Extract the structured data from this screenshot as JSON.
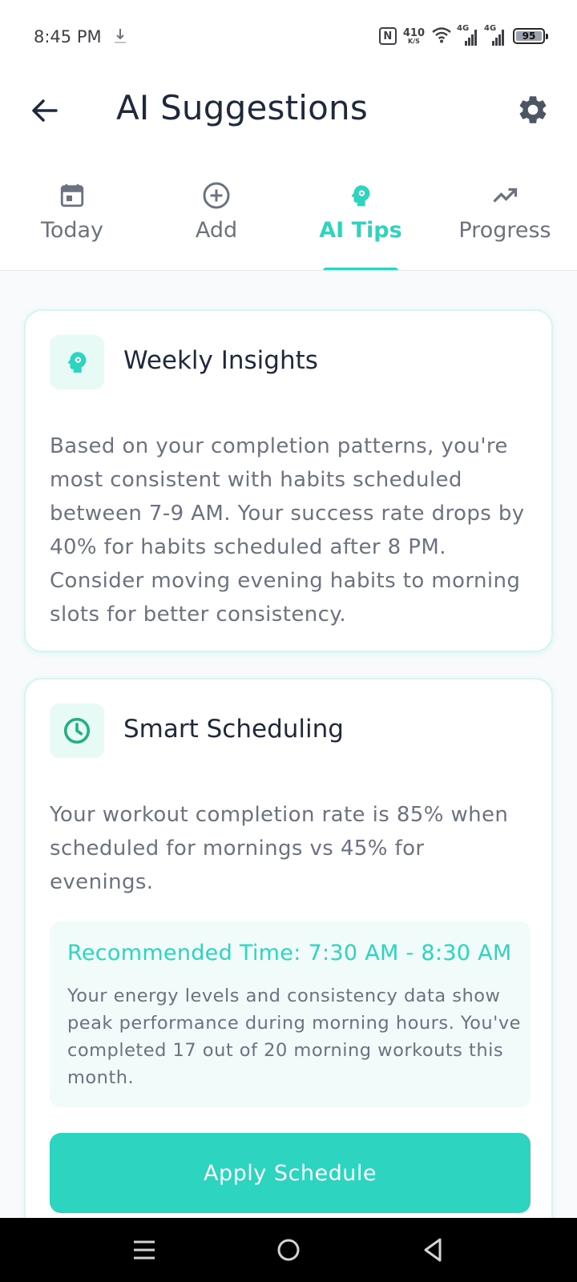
{
  "status_bar": {
    "time": "8:45 PM",
    "speed_value": "410",
    "speed_unit": "K/S",
    "signal1_label": "4G",
    "signal2_label": "4G",
    "battery": "95"
  },
  "header": {
    "title": "AI Suggestions",
    "back_icon": "arrow-left-icon",
    "settings_icon": "gear-icon"
  },
  "tabs": [
    {
      "label": "Today",
      "icon": "calendar-icon",
      "active": false
    },
    {
      "label": "Add",
      "icon": "plus-circle-icon",
      "active": false
    },
    {
      "label": "AI Tips",
      "icon": "brain-head-icon",
      "active": true
    },
    {
      "label": "Progress",
      "icon": "trending-up-icon",
      "active": false
    }
  ],
  "cards": [
    {
      "title": "Weekly Insights",
      "icon": "brain-head-icon",
      "text": "Based on your completion patterns, you're most consistent with habits scheduled between 7-9 AM. Your success rate drops by 40% for habits scheduled after 8 PM. Consider moving evening habits to morning slots for better consistency."
    },
    {
      "title": "Smart Scheduling",
      "icon": "clock-icon",
      "text": "Your workout completion rate is 85% when scheduled for mornings vs 45% for evenings.",
      "recommendation": {
        "title": "Recommended Time: 7:30 AM - 8:30 AM",
        "text": "Your energy levels and consistency data show peak performance during morning hours. You've completed 17 out of 20 morning workouts this month."
      },
      "button_label": "Apply Schedule"
    }
  ],
  "colors": {
    "accent": "#2dd4bf",
    "text_primary": "#1e293b",
    "text_secondary": "#6b7280"
  }
}
